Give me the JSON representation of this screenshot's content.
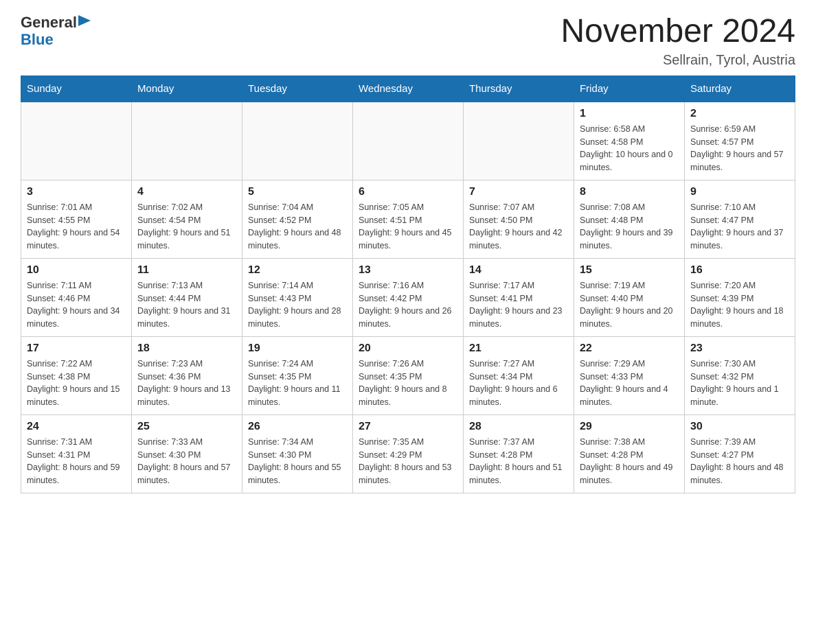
{
  "logo": {
    "general": "General",
    "blue": "Blue"
  },
  "title": "November 2024",
  "location": "Sellrain, Tyrol, Austria",
  "days_of_week": [
    "Sunday",
    "Monday",
    "Tuesday",
    "Wednesday",
    "Thursday",
    "Friday",
    "Saturday"
  ],
  "weeks": [
    [
      {
        "day": "",
        "info": ""
      },
      {
        "day": "",
        "info": ""
      },
      {
        "day": "",
        "info": ""
      },
      {
        "day": "",
        "info": ""
      },
      {
        "day": "",
        "info": ""
      },
      {
        "day": "1",
        "info": "Sunrise: 6:58 AM\nSunset: 4:58 PM\nDaylight: 10 hours and 0 minutes."
      },
      {
        "day": "2",
        "info": "Sunrise: 6:59 AM\nSunset: 4:57 PM\nDaylight: 9 hours and 57 minutes."
      }
    ],
    [
      {
        "day": "3",
        "info": "Sunrise: 7:01 AM\nSunset: 4:55 PM\nDaylight: 9 hours and 54 minutes."
      },
      {
        "day": "4",
        "info": "Sunrise: 7:02 AM\nSunset: 4:54 PM\nDaylight: 9 hours and 51 minutes."
      },
      {
        "day": "5",
        "info": "Sunrise: 7:04 AM\nSunset: 4:52 PM\nDaylight: 9 hours and 48 minutes."
      },
      {
        "day": "6",
        "info": "Sunrise: 7:05 AM\nSunset: 4:51 PM\nDaylight: 9 hours and 45 minutes."
      },
      {
        "day": "7",
        "info": "Sunrise: 7:07 AM\nSunset: 4:50 PM\nDaylight: 9 hours and 42 minutes."
      },
      {
        "day": "8",
        "info": "Sunrise: 7:08 AM\nSunset: 4:48 PM\nDaylight: 9 hours and 39 minutes."
      },
      {
        "day": "9",
        "info": "Sunrise: 7:10 AM\nSunset: 4:47 PM\nDaylight: 9 hours and 37 minutes."
      }
    ],
    [
      {
        "day": "10",
        "info": "Sunrise: 7:11 AM\nSunset: 4:46 PM\nDaylight: 9 hours and 34 minutes."
      },
      {
        "day": "11",
        "info": "Sunrise: 7:13 AM\nSunset: 4:44 PM\nDaylight: 9 hours and 31 minutes."
      },
      {
        "day": "12",
        "info": "Sunrise: 7:14 AM\nSunset: 4:43 PM\nDaylight: 9 hours and 28 minutes."
      },
      {
        "day": "13",
        "info": "Sunrise: 7:16 AM\nSunset: 4:42 PM\nDaylight: 9 hours and 26 minutes."
      },
      {
        "day": "14",
        "info": "Sunrise: 7:17 AM\nSunset: 4:41 PM\nDaylight: 9 hours and 23 minutes."
      },
      {
        "day": "15",
        "info": "Sunrise: 7:19 AM\nSunset: 4:40 PM\nDaylight: 9 hours and 20 minutes."
      },
      {
        "day": "16",
        "info": "Sunrise: 7:20 AM\nSunset: 4:39 PM\nDaylight: 9 hours and 18 minutes."
      }
    ],
    [
      {
        "day": "17",
        "info": "Sunrise: 7:22 AM\nSunset: 4:38 PM\nDaylight: 9 hours and 15 minutes."
      },
      {
        "day": "18",
        "info": "Sunrise: 7:23 AM\nSunset: 4:36 PM\nDaylight: 9 hours and 13 minutes."
      },
      {
        "day": "19",
        "info": "Sunrise: 7:24 AM\nSunset: 4:35 PM\nDaylight: 9 hours and 11 minutes."
      },
      {
        "day": "20",
        "info": "Sunrise: 7:26 AM\nSunset: 4:35 PM\nDaylight: 9 hours and 8 minutes."
      },
      {
        "day": "21",
        "info": "Sunrise: 7:27 AM\nSunset: 4:34 PM\nDaylight: 9 hours and 6 minutes."
      },
      {
        "day": "22",
        "info": "Sunrise: 7:29 AM\nSunset: 4:33 PM\nDaylight: 9 hours and 4 minutes."
      },
      {
        "day": "23",
        "info": "Sunrise: 7:30 AM\nSunset: 4:32 PM\nDaylight: 9 hours and 1 minute."
      }
    ],
    [
      {
        "day": "24",
        "info": "Sunrise: 7:31 AM\nSunset: 4:31 PM\nDaylight: 8 hours and 59 minutes."
      },
      {
        "day": "25",
        "info": "Sunrise: 7:33 AM\nSunset: 4:30 PM\nDaylight: 8 hours and 57 minutes."
      },
      {
        "day": "26",
        "info": "Sunrise: 7:34 AM\nSunset: 4:30 PM\nDaylight: 8 hours and 55 minutes."
      },
      {
        "day": "27",
        "info": "Sunrise: 7:35 AM\nSunset: 4:29 PM\nDaylight: 8 hours and 53 minutes."
      },
      {
        "day": "28",
        "info": "Sunrise: 7:37 AM\nSunset: 4:28 PM\nDaylight: 8 hours and 51 minutes."
      },
      {
        "day": "29",
        "info": "Sunrise: 7:38 AM\nSunset: 4:28 PM\nDaylight: 8 hours and 49 minutes."
      },
      {
        "day": "30",
        "info": "Sunrise: 7:39 AM\nSunset: 4:27 PM\nDaylight: 8 hours and 48 minutes."
      }
    ]
  ]
}
